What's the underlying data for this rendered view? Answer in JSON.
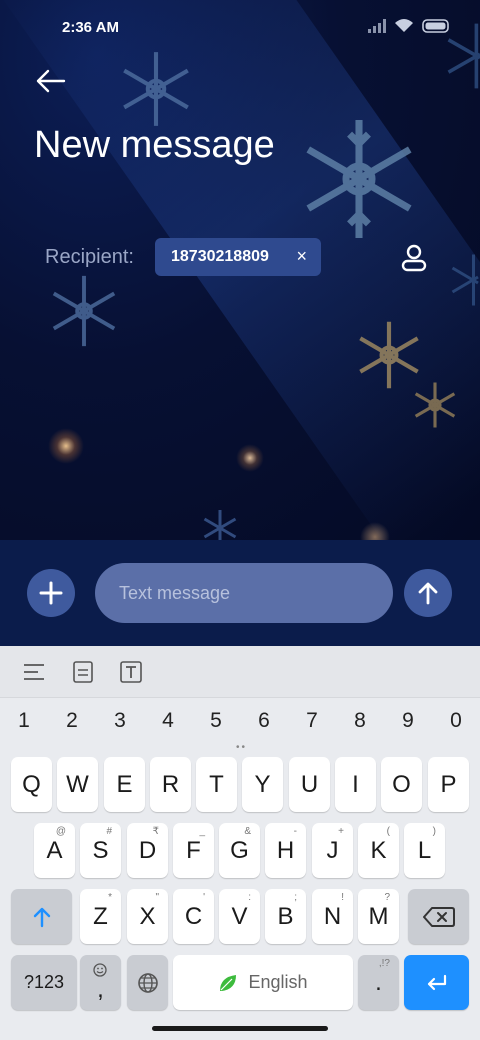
{
  "status_bar": {
    "time": "2:36 AM"
  },
  "header": {
    "title": "New message"
  },
  "recipient": {
    "label": "Recipient:",
    "chip_value": "18730218809",
    "remove_glyph": "×"
  },
  "compose": {
    "placeholder": "Text message"
  },
  "keyboard": {
    "number_row": [
      "1",
      "2",
      "3",
      "4",
      "5",
      "6",
      "7",
      "8",
      "9",
      "0"
    ],
    "row1": [
      "Q",
      "W",
      "E",
      "R",
      "T",
      "Y",
      "U",
      "I",
      "O",
      "P"
    ],
    "row2": [
      "A",
      "S",
      "D",
      "F",
      "G",
      "H",
      "J",
      "K",
      "L"
    ],
    "row2_hints": [
      "@",
      "#",
      "₹",
      "_",
      "&",
      "-",
      "+",
      "(",
      ")"
    ],
    "row3": [
      "Z",
      "X",
      "C",
      "V",
      "B",
      "N",
      "M"
    ],
    "row3_hints": [
      "*",
      "\"",
      "'",
      ":",
      ";",
      "!",
      "?"
    ],
    "symbols_key": "?123",
    "comma_key": ",",
    "space_label": "English",
    "period_key": ".",
    "period_hint": ",!?",
    "accent_color": "#1e90ff"
  },
  "theme": {
    "compose_bg": "#0b1c4b",
    "chip_bg": "#2f4a8f",
    "input_bg": "#5b6fa8"
  }
}
